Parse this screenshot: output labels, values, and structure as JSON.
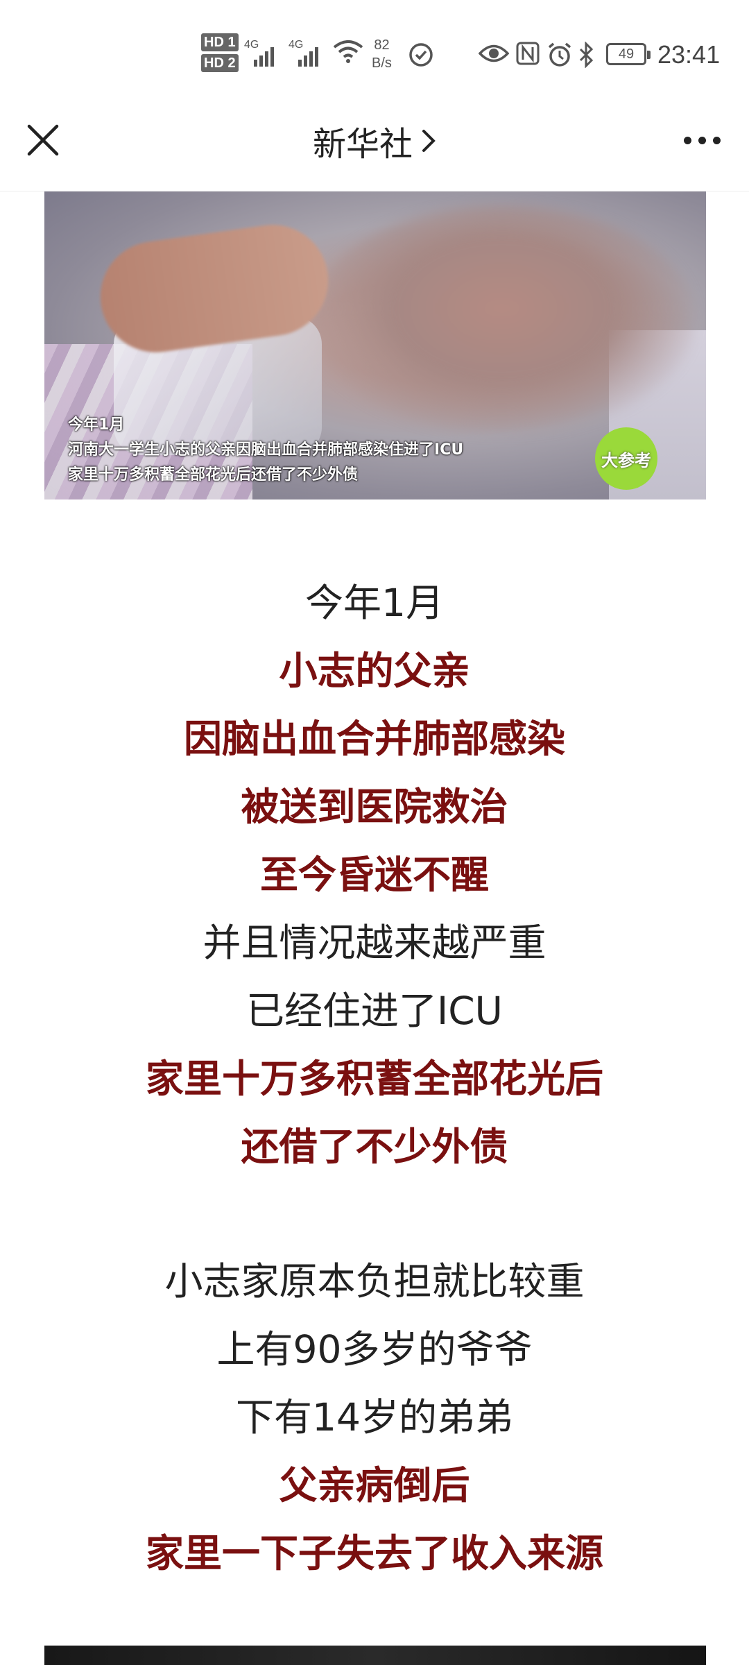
{
  "status_bar": {
    "hd1": "HD 1",
    "hd2": "HD 2",
    "net1": "4G",
    "net2": "4G",
    "speed_value": "82",
    "speed_unit": "B/s",
    "battery": "49",
    "time": "23:41",
    "icons": [
      "signal-icon",
      "wifi-icon",
      "clock-check-icon",
      "eye-icon",
      "nfc-icon",
      "alarm-icon",
      "bluetooth-icon",
      "battery-icon"
    ]
  },
  "header": {
    "title": "新华社",
    "close_icon": "close-icon",
    "more_icon": "more-icon"
  },
  "image": {
    "captions": [
      "今年1月",
      "河南大一学生小志的父亲因脑出血合并肺部感染住进了ICU",
      "家里十万多积蓄全部花光后还借了不少外债"
    ],
    "logo_text": "大参考"
  },
  "article": {
    "para1": [
      {
        "text": "今年1月",
        "bold": false
      },
      {
        "text": "小志的父亲",
        "bold": true
      },
      {
        "text": "因脑出血合并肺部感染",
        "bold": true
      },
      {
        "text": "被送到医院救治",
        "bold": true
      },
      {
        "text": "至今昏迷不醒",
        "bold": true
      },
      {
        "text": "并且情况越来越严重",
        "bold": false
      },
      {
        "text": "已经住进了ICU",
        "bold": false
      },
      {
        "text": "家里十万多积蓄全部花光后",
        "bold": true
      },
      {
        "text": "还借了不少外债",
        "bold": true
      }
    ],
    "para2": [
      {
        "text": "小志家原本负担就比较重",
        "bold": false
      },
      {
        "text": "上有90多岁的爷爷",
        "bold": false
      },
      {
        "text": "下有14岁的弟弟",
        "bold": false
      },
      {
        "text": "父亲病倒后",
        "bold": true
      },
      {
        "text": "家里一下子失去了收入来源",
        "bold": true
      }
    ]
  },
  "colors": {
    "emphasis": "#7a1010",
    "text": "#222222",
    "logo_green": "#9ad93a"
  }
}
